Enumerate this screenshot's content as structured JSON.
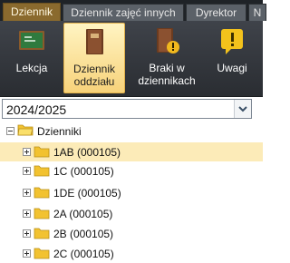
{
  "tabs": [
    {
      "label": "Dziennik",
      "active": true
    },
    {
      "label": "Dziennik zajęć innych",
      "active": false
    },
    {
      "label": "Dyrektor",
      "active": false
    },
    {
      "label": "N",
      "active": false
    }
  ],
  "ribbon": {
    "lekcja": "Lekcja",
    "dziennik_oddzialu": [
      "Dziennik",
      "oddziału"
    ],
    "braki": [
      "Braki w",
      "dziennikach"
    ],
    "uwagi": "Uwagi"
  },
  "year_select": {
    "value": "2024/2025"
  },
  "tree": {
    "root_label": "Dzienniki",
    "items": [
      {
        "label": "1AB (000105)",
        "selected": true
      },
      {
        "label": "1C (000105)",
        "selected": false
      },
      {
        "label": "1DE (000105)",
        "selected": false
      },
      {
        "label": "2A (000105)",
        "selected": false
      },
      {
        "label": "2B (000105)",
        "selected": false
      },
      {
        "label": "2C (000105)",
        "selected": false
      }
    ]
  },
  "colors": {
    "accent": "#8a6a2e",
    "selection": "#fcebb8",
    "folder": "#f2c230",
    "ribbon": "#3f434a"
  }
}
